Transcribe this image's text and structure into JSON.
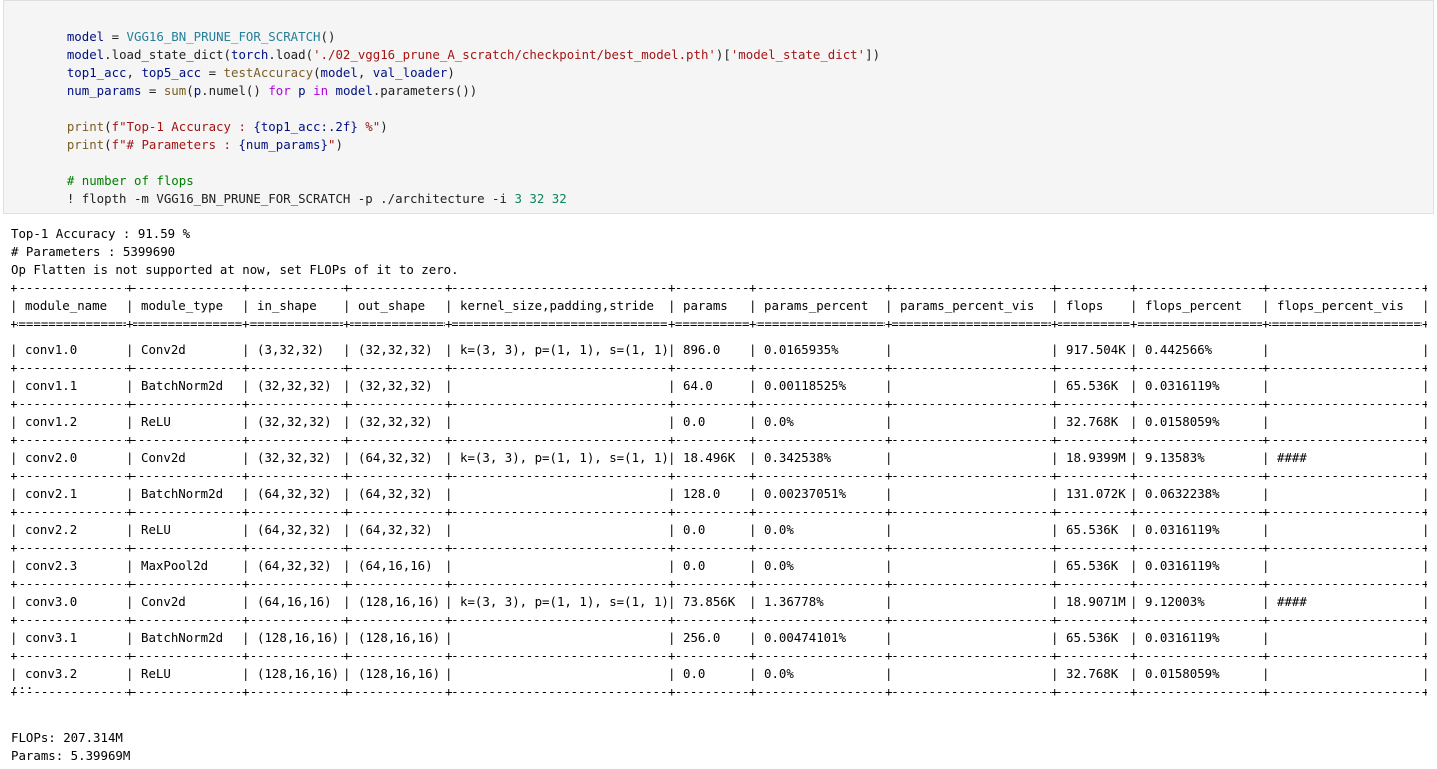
{
  "code": {
    "lines": [
      "model = VGG16_BN_PRUNE_FOR_SCRATCH()",
      "model.load_state_dict(torch.load('./02_vgg16_prune_A_scratch/checkpoint/best_model.pth')['model_state_dict'])",
      "top1_acc, top5_acc = testAccuracy(model, val_loader)",
      "num_params = sum(p.numel() for p in model.parameters())",
      "",
      "print(f\"Top-1 Accuracy : {top1_acc:.2f} %\")",
      "print(f\"# Parameters : {num_params}\")",
      "",
      "# number of flops",
      "! flopth -m VGG16_BN_PRUNE_FOR_SCRATCH -p ./architecture -i 3 32 32"
    ]
  },
  "output": {
    "top1": "Top-1 Accuracy : 91.59 %",
    "params": "# Parameters : 5399690",
    "warning": "Op Flatten is not supported at now, set FLOPs of it to zero.",
    "ellipsis": "...",
    "flops_total": "FLOPs: 207.314M",
    "params_total": "Params: 5.39969M"
  },
  "table": {
    "columns": [
      "module_name",
      "module_type",
      "in_shape",
      "out_shape",
      "kernel_size,padding,stride",
      "params",
      "params_percent",
      "params_percent_vis",
      "flops",
      "flops_percent",
      "flops_percent_vis"
    ],
    "rows": [
      [
        "conv1.0",
        "Conv2d",
        "(3,32,32)",
        "(32,32,32)",
        "k=(3, 3), p=(1, 1), s=(1, 1)",
        "896.0",
        "0.0165935%",
        "",
        "917.504K",
        "0.442566%",
        ""
      ],
      [
        "conv1.1",
        "BatchNorm2d",
        "(32,32,32)",
        "(32,32,32)",
        "",
        "64.0",
        "0.00118525%",
        "",
        "65.536K",
        "0.0316119%",
        ""
      ],
      [
        "conv1.2",
        "ReLU",
        "(32,32,32)",
        "(32,32,32)",
        "",
        "0.0",
        "0.0%",
        "",
        "32.768K",
        "0.0158059%",
        ""
      ],
      [
        "conv2.0",
        "Conv2d",
        "(32,32,32)",
        "(64,32,32)",
        "k=(3, 3), p=(1, 1), s=(1, 1)",
        "18.496K",
        "0.342538%",
        "",
        "18.9399M",
        "9.13583%",
        "####"
      ],
      [
        "conv2.1",
        "BatchNorm2d",
        "(64,32,32)",
        "(64,32,32)",
        "",
        "128.0",
        "0.00237051%",
        "",
        "131.072K",
        "0.0632238%",
        ""
      ],
      [
        "conv2.2",
        "ReLU",
        "(64,32,32)",
        "(64,32,32)",
        "",
        "0.0",
        "0.0%",
        "",
        "65.536K",
        "0.0316119%",
        ""
      ],
      [
        "conv2.3",
        "MaxPool2d",
        "(64,32,32)",
        "(64,16,16)",
        "",
        "0.0",
        "0.0%",
        "",
        "65.536K",
        "0.0316119%",
        ""
      ],
      [
        "conv3.0",
        "Conv2d",
        "(64,16,16)",
        "(128,16,16)",
        "k=(3, 3), p=(1, 1), s=(1, 1)",
        "73.856K",
        "1.36778%",
        "",
        "18.9071M",
        "9.12003%",
        "####"
      ],
      [
        "conv3.1",
        "BatchNorm2d",
        "(128,16,16)",
        "(128,16,16)",
        "",
        "256.0",
        "0.00474101%",
        "",
        "65.536K",
        "0.0316119%",
        ""
      ],
      [
        "conv3.2",
        "ReLU",
        "(128,16,16)",
        "(128,16,16)",
        "",
        "0.0",
        "0.0%",
        "",
        "32.768K",
        "0.0158059%",
        ""
      ]
    ]
  }
}
